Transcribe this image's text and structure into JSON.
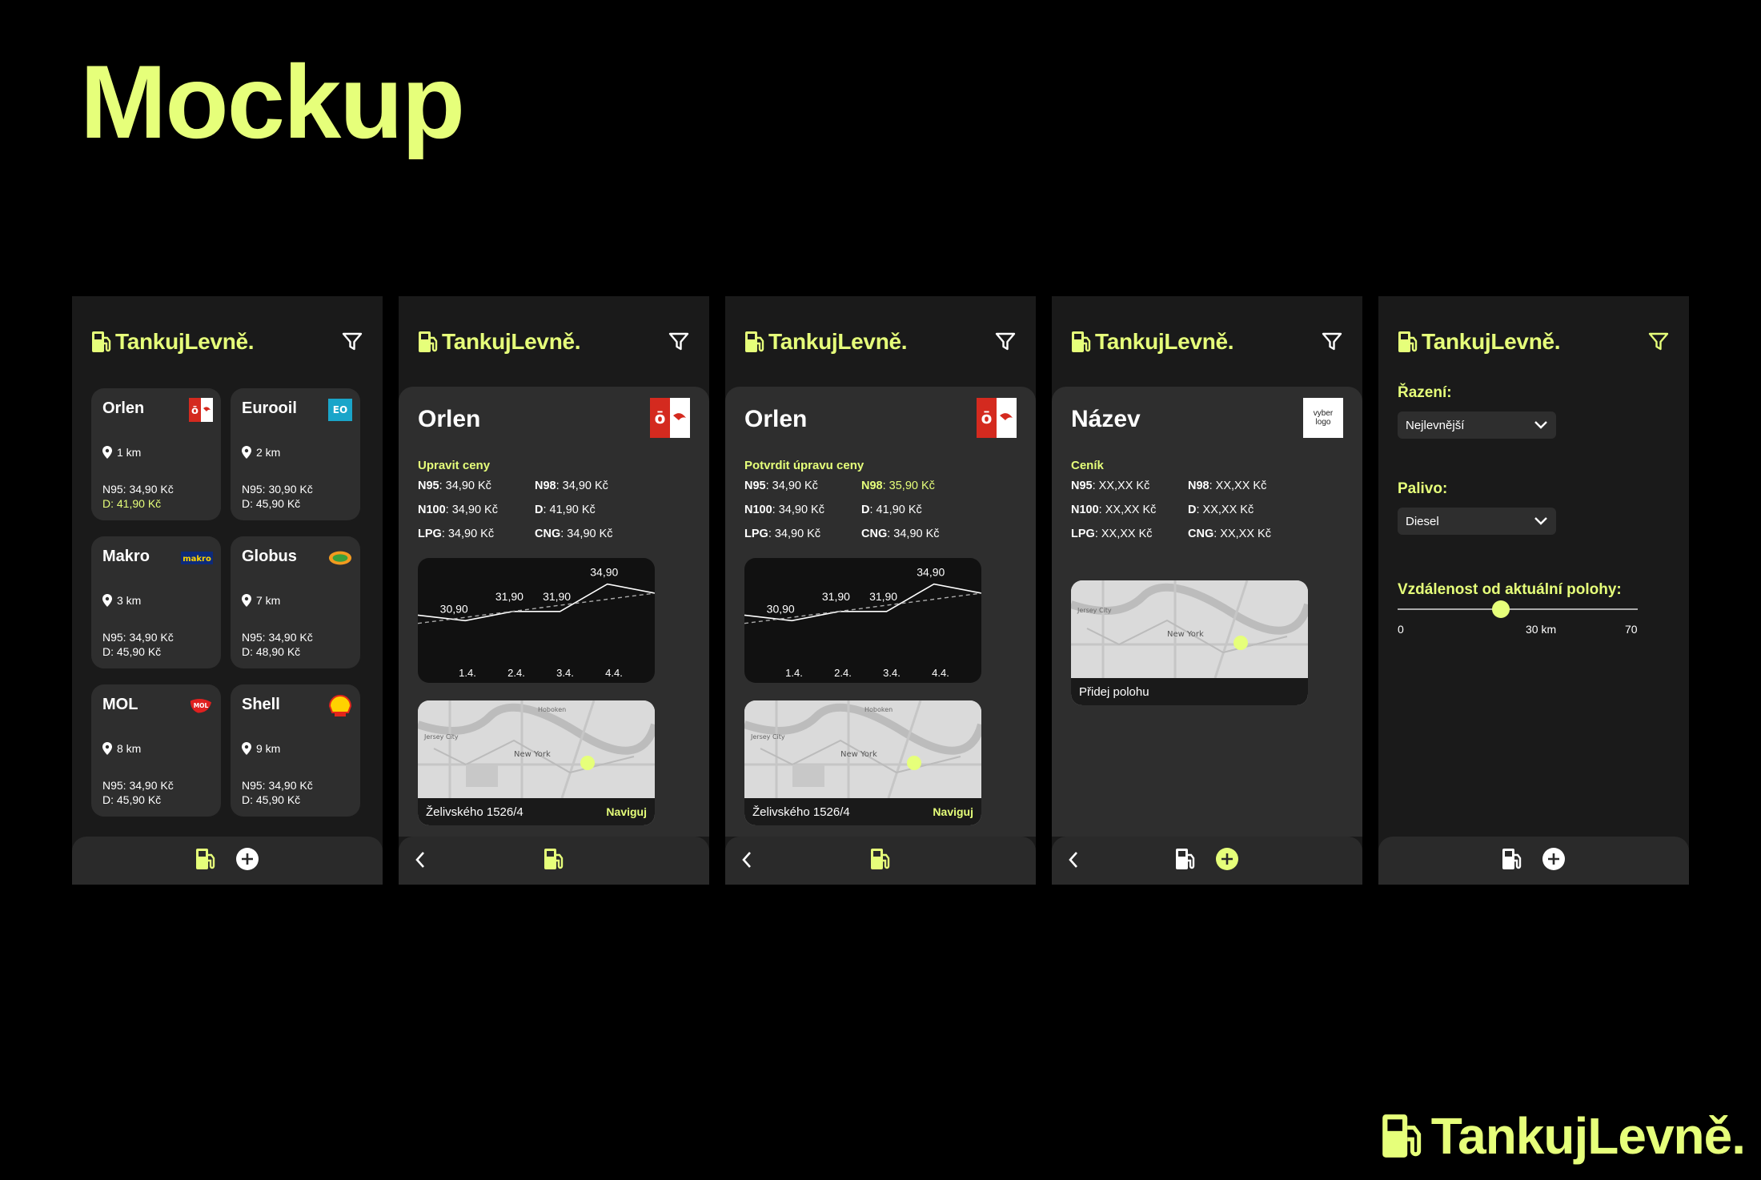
{
  "page": {
    "title": "Mockup"
  },
  "brand": {
    "name": "TankujLevně."
  },
  "screens": {
    "list": {
      "cards": [
        {
          "name": "Orlen",
          "dist": "1 km",
          "price1": "N95: 34,90 Kč",
          "price2": "D: 41,90 Kč",
          "logo": "orlen-logo",
          "highlight": true
        },
        {
          "name": "Eurooil",
          "dist": "2 km",
          "price1": "N95: 30,90 Kč",
          "price2": "D: 45,90 Kč",
          "logo": "eurooil-logo"
        },
        {
          "name": "Makro",
          "dist": "3 km",
          "price1": "N95: 34,90 Kč",
          "price2": "D: 45,90 Kč",
          "logo": "makro-logo"
        },
        {
          "name": "Globus",
          "dist": "7 km",
          "price1": "N95: 34,90 Kč",
          "price2": "D: 48,90 Kč",
          "logo": "globus-logo"
        },
        {
          "name": "MOL",
          "dist": "8 km",
          "price1": "N95: 34,90 Kč",
          "price2": "D: 45,90 Kč",
          "logo": "mol-logo"
        },
        {
          "name": "Shell",
          "dist": "9 km",
          "price1": "N95: 34,90 Kč",
          "price2": "D: 45,90 Kč",
          "logo": "shell-logo"
        }
      ]
    },
    "detail": {
      "name": "Orlen",
      "section": "Upravit ceny",
      "prices": {
        "n95": ": 34,90 Kč",
        "n98": ": 34,90 Kč",
        "n100": ": 34,90 Kč",
        "d": ": 41,90 Kč",
        "lpg": ": 34,90 Kč",
        "cng": ": 34,90 Kč"
      },
      "address": "Želivského 1526/4",
      "navigate": "Naviguj"
    },
    "edit": {
      "name": "Orlen",
      "section": "Potvrdit úpravu ceny",
      "prices": {
        "n95": ": 34,90 Kč",
        "n98": ": 35,90 Kč",
        "n100": ": 34,90 Kč",
        "d": ": 41,90 Kč",
        "lpg": ": 34,90 Kč",
        "cng": ": 34,90 Kč"
      },
      "address": "Želivského 1526/4",
      "navigate": "Naviguj"
    },
    "new": {
      "name": "Název",
      "logo_text": "vyber logo",
      "section": "Ceník",
      "prices": {
        "n95": ": XX,XX Kč",
        "n98": ": XX,XX Kč",
        "n100": ": XX,XX Kč",
        "d": ": XX,XX Kč",
        "lpg": ": XX,XX Kč",
        "cng": ": XX,XX Kč"
      },
      "add_location": "Přidej polohu"
    },
    "filter": {
      "sort_label": "Řazení:",
      "sort_value": "Nejlevnější",
      "fuel_label": "Palivo:",
      "fuel_value": "Diesel",
      "distance_label": "Vzdálenost od aktuální polohy:",
      "slider_min": "0",
      "slider_value": "30 km",
      "slider_max": "70",
      "slider_fraction": 0.43
    }
  },
  "fuel_labels": {
    "n95": "N95",
    "n98": "N98",
    "n100": "N100",
    "d": "D",
    "lpg": "LPG",
    "cng": "CNG"
  },
  "map_labels": {
    "city1": "Jersey City",
    "city2": "New York",
    "city3": "Hoboken"
  },
  "chart_data": {
    "type": "line",
    "categories": [
      "1.4.",
      "2.4.",
      "3.4.",
      "4.4."
    ],
    "data_labels": [
      "30,90",
      "31,90",
      "31,90",
      "34,90"
    ],
    "series": [
      {
        "values": [
          31.5,
          30.9,
          31.9,
          31.9,
          34.9,
          33.9
        ]
      }
    ],
    "trend": "dashed"
  },
  "colors": {
    "accent": "#e6ff7a",
    "panel": "#1a1a1a",
    "card": "#2e2e2e",
    "orlen": "#d42a1f"
  }
}
